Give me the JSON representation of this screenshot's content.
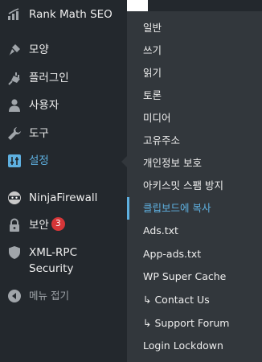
{
  "sidebar": {
    "items": [
      {
        "label": "Rank Math SEO",
        "icon": "rank-math-icon"
      },
      {
        "label": "모양",
        "icon": "appearance-brush-icon"
      },
      {
        "label": "플러그인",
        "icon": "plugins-plug-icon"
      },
      {
        "label": "사용자",
        "icon": "users-person-icon"
      },
      {
        "label": "도구",
        "icon": "tools-wrench-icon"
      },
      {
        "label": "설정",
        "icon": "settings-sliders-icon"
      },
      {
        "label": "NinjaFirewall",
        "icon": "ninja-icon"
      },
      {
        "label": "보안",
        "icon": "lock-icon",
        "badge": "3"
      },
      {
        "label": "XML-RPC Security",
        "label_line1": "XML-RPC",
        "label_line2": "Security",
        "icon": "shield-icon"
      },
      {
        "label": "메뉴 접기",
        "icon": "collapse-arrow-icon"
      }
    ]
  },
  "submenu": {
    "items": [
      {
        "label": "일반"
      },
      {
        "label": "쓰기"
      },
      {
        "label": "읽기"
      },
      {
        "label": "토론"
      },
      {
        "label": "미디어"
      },
      {
        "label": "고유주소"
      },
      {
        "label": "개인정보 보호"
      },
      {
        "label": "아키스밋 스팸 방지"
      },
      {
        "label": "클립보드에 복사",
        "current": true
      },
      {
        "label": "Ads.txt"
      },
      {
        "label": "App-ads.txt"
      },
      {
        "label": "WP Super Cache"
      },
      {
        "label": "↳ Contact Us"
      },
      {
        "label": "↳ Support Forum"
      },
      {
        "label": "Login Lockdown"
      }
    ]
  },
  "colors": {
    "sidebar_bg": "#23282d",
    "submenu_bg": "#32373c",
    "text": "#eeeeee",
    "accent": "#5eb0e0",
    "badge": "#d63638",
    "muted": "#a0a5aa"
  }
}
